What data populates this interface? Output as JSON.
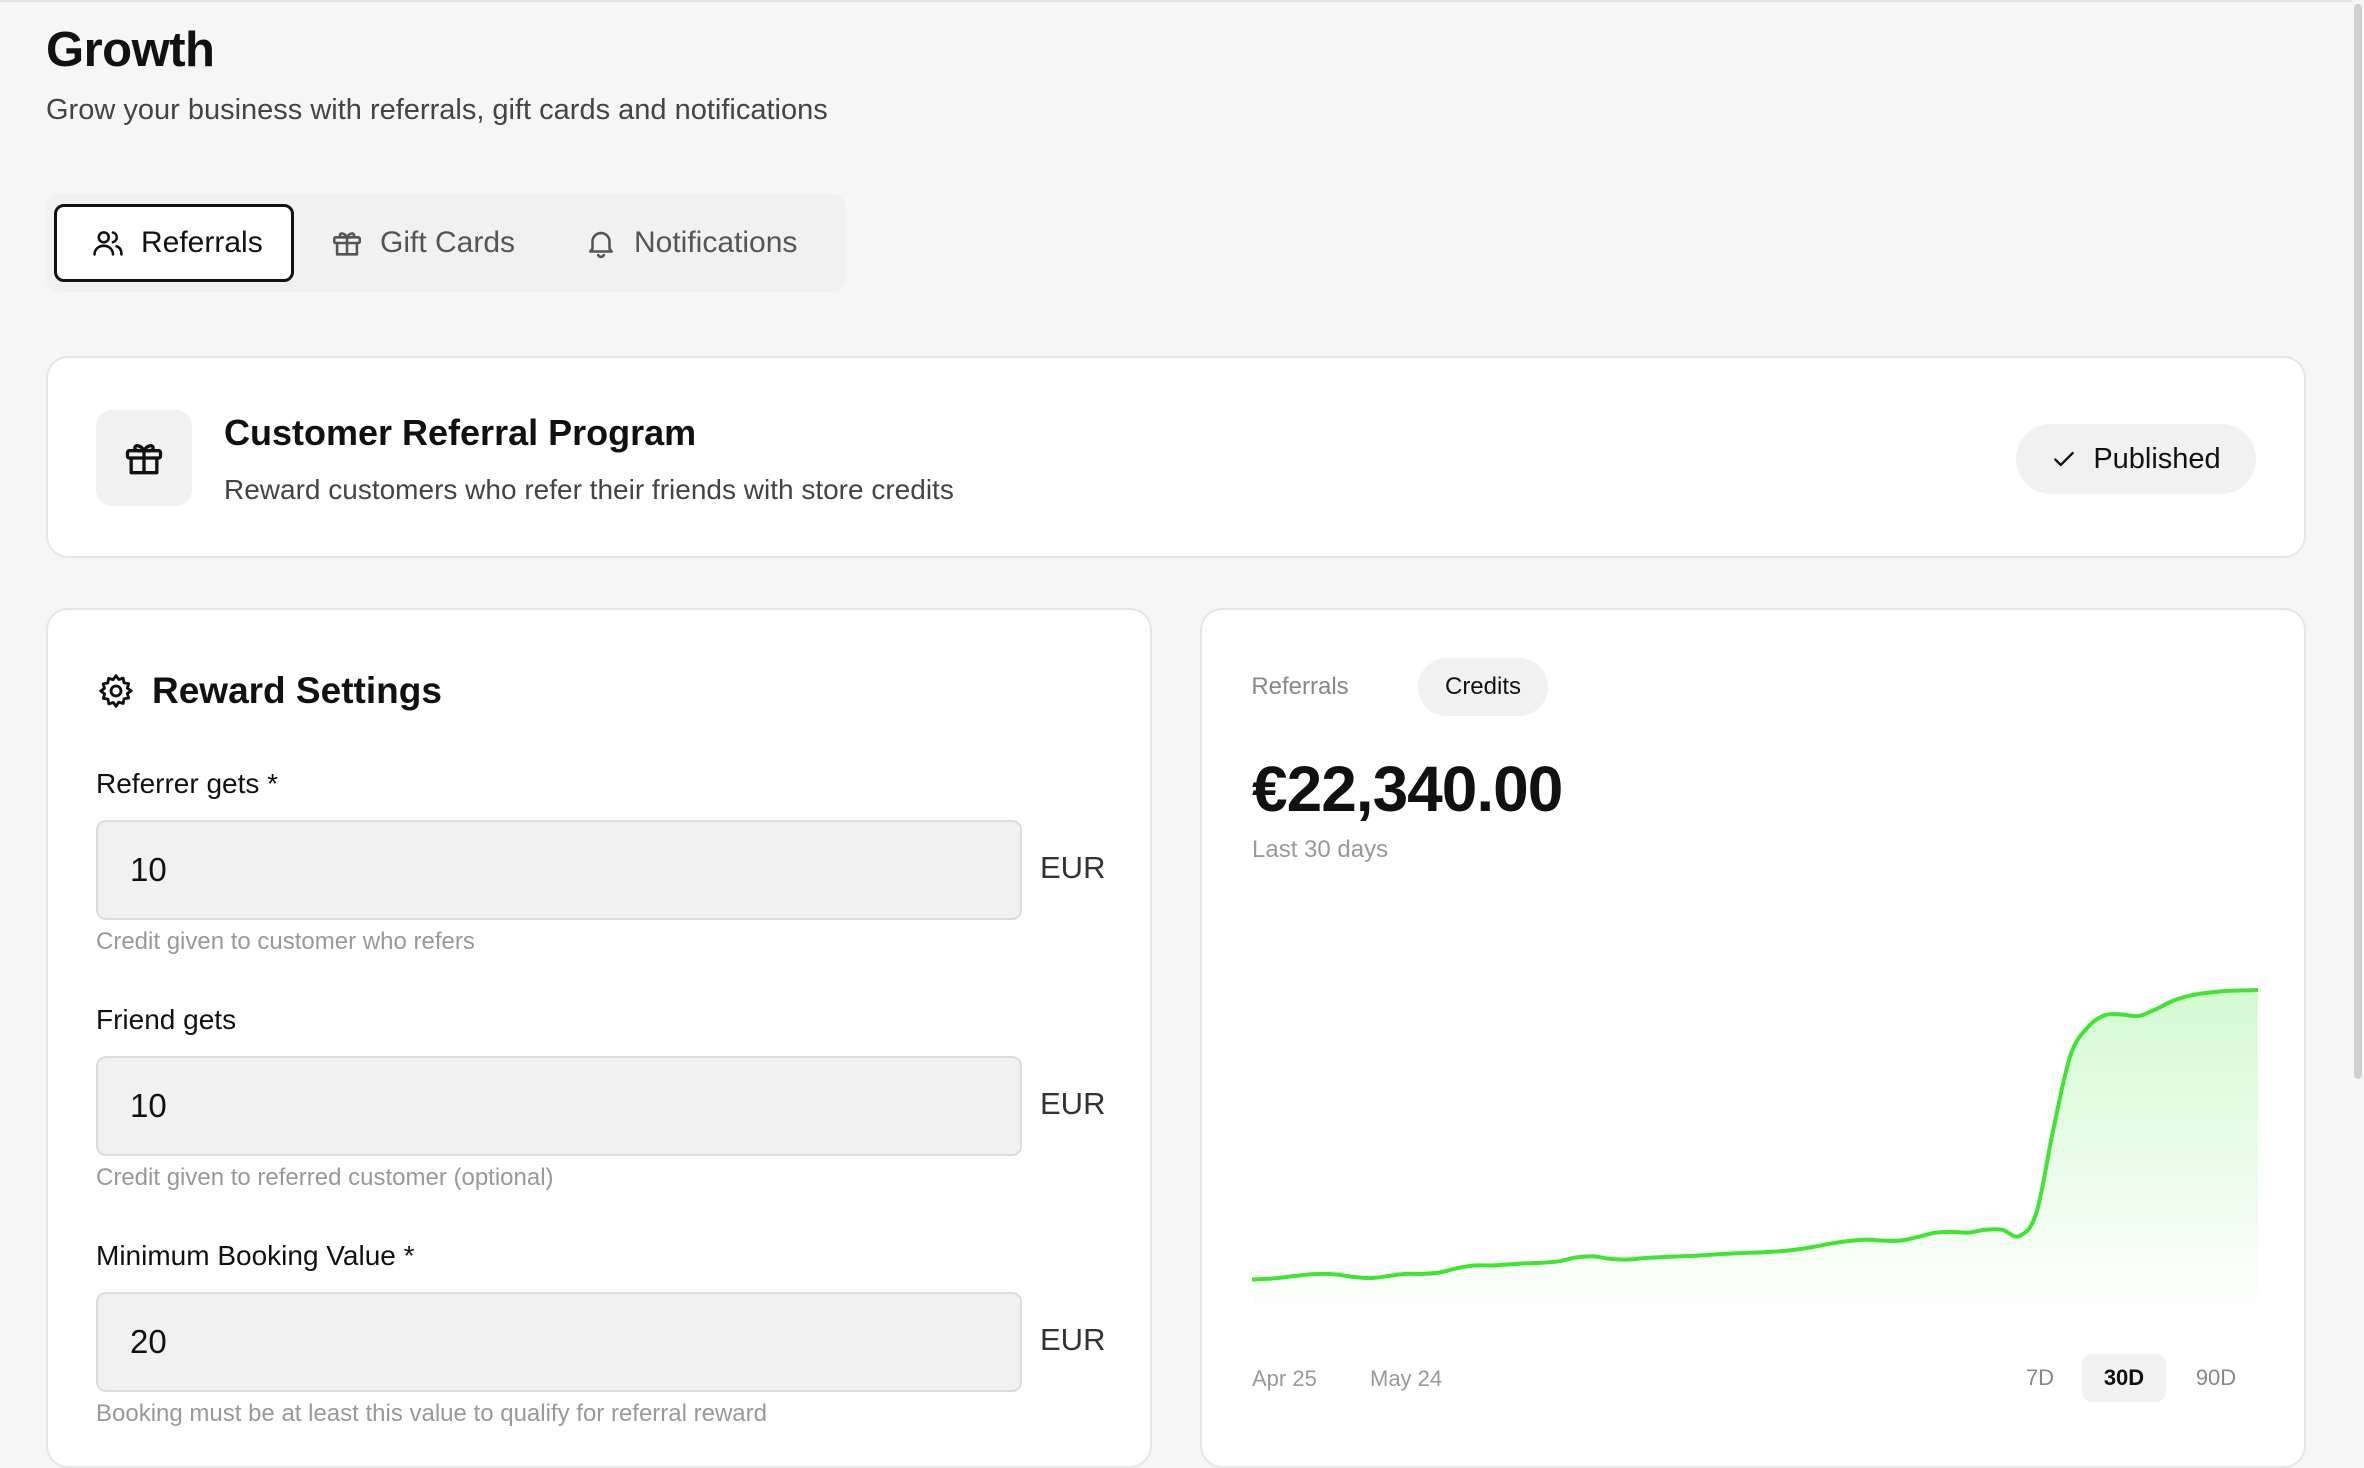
{
  "page": {
    "title": "Growth",
    "subtitle": "Grow your business with referrals, gift cards and notifications"
  },
  "tabs": [
    {
      "label": "Referrals",
      "icon": "users-icon",
      "active": true
    },
    {
      "label": "Gift Cards",
      "icon": "gift-icon",
      "active": false
    },
    {
      "label": "Notifications",
      "icon": "bell-icon",
      "active": false
    }
  ],
  "program": {
    "title": "Customer Referral Program",
    "description": "Reward customers who refer their friends with store credits",
    "status": "Published",
    "icon": "gift-icon"
  },
  "settings": {
    "title": "Reward Settings",
    "icon": "gear-icon",
    "fields": [
      {
        "label": "Referrer gets *",
        "value": "10",
        "unit": "EUR",
        "help": "Credit given to customer who refers"
      },
      {
        "label": "Friend gets",
        "value": "10",
        "unit": "EUR",
        "help": "Credit given to referred customer (optional)"
      },
      {
        "label": "Minimum Booking Value *",
        "value": "20",
        "unit": "EUR",
        "help": "Booking must be at least this value to qualify for referral reward"
      }
    ]
  },
  "stats": {
    "segments": [
      {
        "label": "Referrals",
        "active": false
      },
      {
        "label": "Credits",
        "active": true
      }
    ],
    "value": "€22,340.00",
    "period": "Last 30 days",
    "x_labels": [
      "Apr 25",
      "May 24"
    ],
    "ranges": [
      {
        "label": "7D",
        "active": false
      },
      {
        "label": "30D",
        "active": true
      },
      {
        "label": "90D",
        "active": false
      }
    ],
    "accent": "#3ee632"
  },
  "chart_data": {
    "type": "area",
    "title": "",
    "xlabel": "",
    "ylabel": "",
    "grid": false,
    "ylim": [
      0,
      100
    ],
    "x": [
      0,
      1,
      2,
      3,
      4,
      5,
      6,
      7,
      8,
      9,
      10,
      11,
      12,
      13,
      14,
      15,
      16,
      17,
      18,
      19,
      20,
      21,
      22,
      23,
      24,
      25,
      26,
      27,
      28,
      29,
      30,
      31,
      32,
      33,
      34,
      35,
      36,
      37,
      38,
      39,
      40,
      41,
      42,
      43,
      44,
      45,
      46,
      47,
      48,
      49,
      50,
      51,
      52,
      53,
      54,
      55,
      56,
      57,
      58,
      59
    ],
    "series": [
      {
        "values": [
          3.0,
          3.2,
          3.7,
          4.3,
          4.6,
          4.4,
          3.7,
          3.4,
          4.0,
          4.6,
          4.6,
          5.0,
          6.2,
          7.0,
          7.0,
          7.3,
          7.6,
          7.8,
          8.2,
          9.3,
          9.6,
          8.9,
          8.7,
          9.1,
          9.4,
          9.6,
          9.8,
          10.1,
          10.4,
          10.6,
          10.8,
          11.1,
          11.6,
          12.4,
          13.3,
          14.0,
          14.4,
          14.1,
          14.1,
          15.1,
          16.3,
          16.6,
          16.4,
          17.2,
          17.2,
          15.4,
          22.0,
          46.0,
          67.0,
          75.0,
          78.5,
          78.7,
          78.3,
          80.2,
          82.6,
          84.1,
          84.9,
          85.4,
          85.6,
          85.7
        ]
      }
    ]
  }
}
